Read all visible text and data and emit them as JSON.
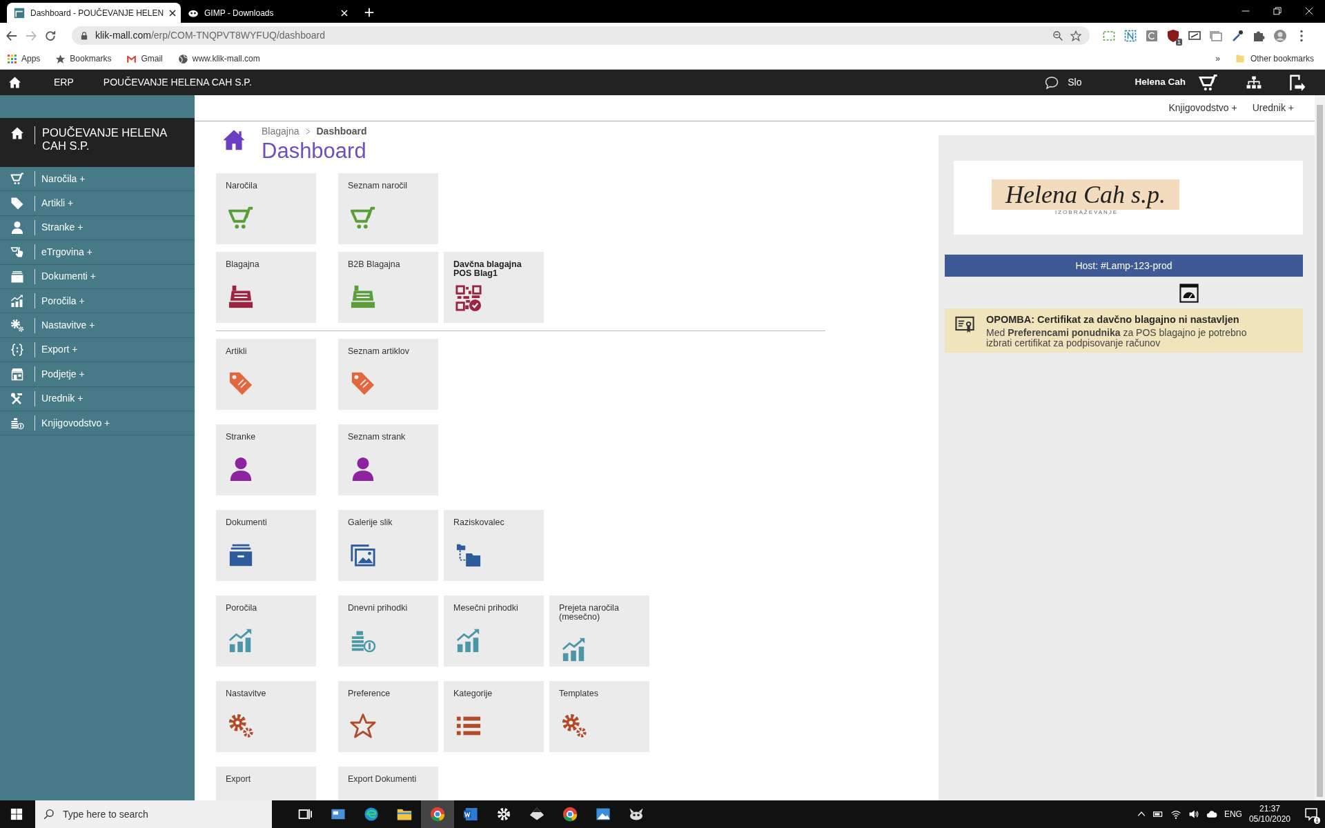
{
  "browser": {
    "tabs": [
      {
        "title": "Dashboard - POUČEVANJE HELEN",
        "selected": true
      },
      {
        "title": "GIMP - Downloads",
        "selected": false
      }
    ],
    "url_domain": "klik-mall.com",
    "url_path": "/erp/COM-TNQPVT8WYFUQ/dashboard",
    "extension_badge": "1",
    "bookmarks": [
      {
        "label": "Apps",
        "kind": "apps"
      },
      {
        "label": "Bookmarks",
        "kind": "star"
      },
      {
        "label": "Gmail",
        "kind": "gmail"
      },
      {
        "label": "www.klik-mall.com",
        "kind": "globe"
      }
    ],
    "bookmarks_overflow": "»",
    "other_bookmarks": "Other bookmarks"
  },
  "navbar": {
    "module": "ERP",
    "company": "POUČEVANJE HELENA CAH S.P.",
    "language": "Slo",
    "user": "Helena Cah"
  },
  "top_links": [
    "Knjigovodstvo +",
    "Urednik +"
  ],
  "sidebar": {
    "title": "POUČEVANJE HELENA CAH S.P.",
    "items": [
      {
        "label": "Naročila +",
        "kind": "cart"
      },
      {
        "label": "Artikli +",
        "kind": "tag"
      },
      {
        "label": "Stranke +",
        "kind": "person"
      },
      {
        "label": "eTrgovina +",
        "kind": "hand"
      },
      {
        "label": "Dokumenti +",
        "kind": "drawer"
      },
      {
        "label": "Poročila +",
        "kind": "chart"
      },
      {
        "label": "Nastavitve +",
        "kind": "gears"
      },
      {
        "label": "Export +",
        "kind": "braces"
      },
      {
        "label": "Podjetje +",
        "kind": "shop"
      },
      {
        "label": "Urednik +",
        "kind": "tools"
      },
      {
        "label": "Knjigovodstvo +",
        "kind": "coins"
      }
    ]
  },
  "breadcrumb": [
    "Blagajna",
    "Dashboard"
  ],
  "page_title": "Dashboard",
  "tile_groups": [
    [
      [
        {
          "label": "Naročila",
          "kind": "cart",
          "color": "#5a9e3a",
          "bold": false
        },
        {
          "label": "Seznam naročil",
          "kind": "cart",
          "color": "#5a9e3a",
          "bold": false
        }
      ],
      [
        {
          "label": "Blagajna",
          "kind": "register",
          "color": "#9b2540",
          "bold": false
        },
        {
          "label": "B2B Blagajna",
          "kind": "register",
          "color": "#5a9e3a",
          "bold": false
        },
        {
          "label": "Davčna blagajna POS Blag1",
          "kind": "qr",
          "color": "#9b2540",
          "bold": true
        }
      ]
    ],
    [
      [
        {
          "label": "Artikli",
          "kind": "tag",
          "color": "#e2673f",
          "bold": false
        },
        {
          "label": "Seznam artiklov",
          "kind": "tag",
          "color": "#e2673f",
          "bold": false
        }
      ],
      [
        {
          "label": "Stranke",
          "kind": "person",
          "color": "#8e23a0",
          "bold": false
        },
        {
          "label": "Seznam strank",
          "kind": "person",
          "color": "#8e23a0",
          "bold": false
        }
      ],
      [
        {
          "label": "Dokumenti",
          "kind": "drawer",
          "color": "#2e5b9c",
          "bold": false
        },
        {
          "label": "Galerije slik",
          "kind": "gallery",
          "color": "#2e5b9c",
          "bold": false
        },
        {
          "label": "Raziskovalec",
          "kind": "tree",
          "color": "#2e5b9c",
          "bold": false
        }
      ],
      [
        {
          "label": "Poročila",
          "kind": "chart",
          "color": "#4b97a8",
          "bold": false
        },
        {
          "label": "Dnevni prihodki",
          "kind": "coins",
          "color": "#4b97a8",
          "bold": false
        },
        {
          "label": "Mesečni prihodki",
          "kind": "chart",
          "color": "#4b97a8",
          "bold": false
        },
        {
          "label": "Prejeta naročila (mesečno)",
          "kind": "chart",
          "color": "#4b97a8",
          "bold": false
        }
      ],
      [
        {
          "label": "Nastavitve",
          "kind": "gears",
          "color": "#b34a2a",
          "bold": false
        },
        {
          "label": "Preference",
          "kind": "star",
          "color": "#b34a2a",
          "bold": false
        },
        {
          "label": "Kategorije",
          "kind": "list",
          "color": "#b34a2a",
          "bold": false
        },
        {
          "label": "Templates",
          "kind": "gears",
          "color": "#b34a2a",
          "bold": false
        }
      ],
      [
        {
          "label": "Export",
          "kind": "none",
          "bold": false
        },
        {
          "label": "Export Dokumenti",
          "kind": "none",
          "bold": false
        }
      ]
    ]
  ],
  "right_panel": {
    "logo": {
      "name": "Helena Cah s.p.",
      "tagline": "IZOBRAŽEVANJE"
    },
    "host": "Host: #Lamp-123-prod",
    "notice": {
      "title": "OPOMBA: Certifikat za davčno blagajno ni nastavljen",
      "text": "Med **Preferencami ponudnika** za POS blagajno je potrebno izbrati certifikat za podpisovanje računov"
    }
  },
  "taskbar": {
    "search_placeholder": "Type here to search",
    "apps": [
      {
        "kind": "taskview",
        "selected": false
      },
      {
        "kind": "app",
        "selected": false
      },
      {
        "kind": "edge",
        "selected": false
      },
      {
        "kind": "explorer",
        "selected": false
      },
      {
        "kind": "chrome",
        "selected": true
      },
      {
        "kind": "word",
        "selected": false
      },
      {
        "kind": "settings",
        "selected": false
      },
      {
        "kind": "inkscape",
        "selected": false
      },
      {
        "kind": "chrome",
        "selected": false
      },
      {
        "kind": "photos",
        "selected": false
      },
      {
        "kind": "gimp",
        "selected": false
      }
    ],
    "language": "ENG",
    "time": "21:37",
    "date": "05/10/2020",
    "notifications": "1"
  }
}
